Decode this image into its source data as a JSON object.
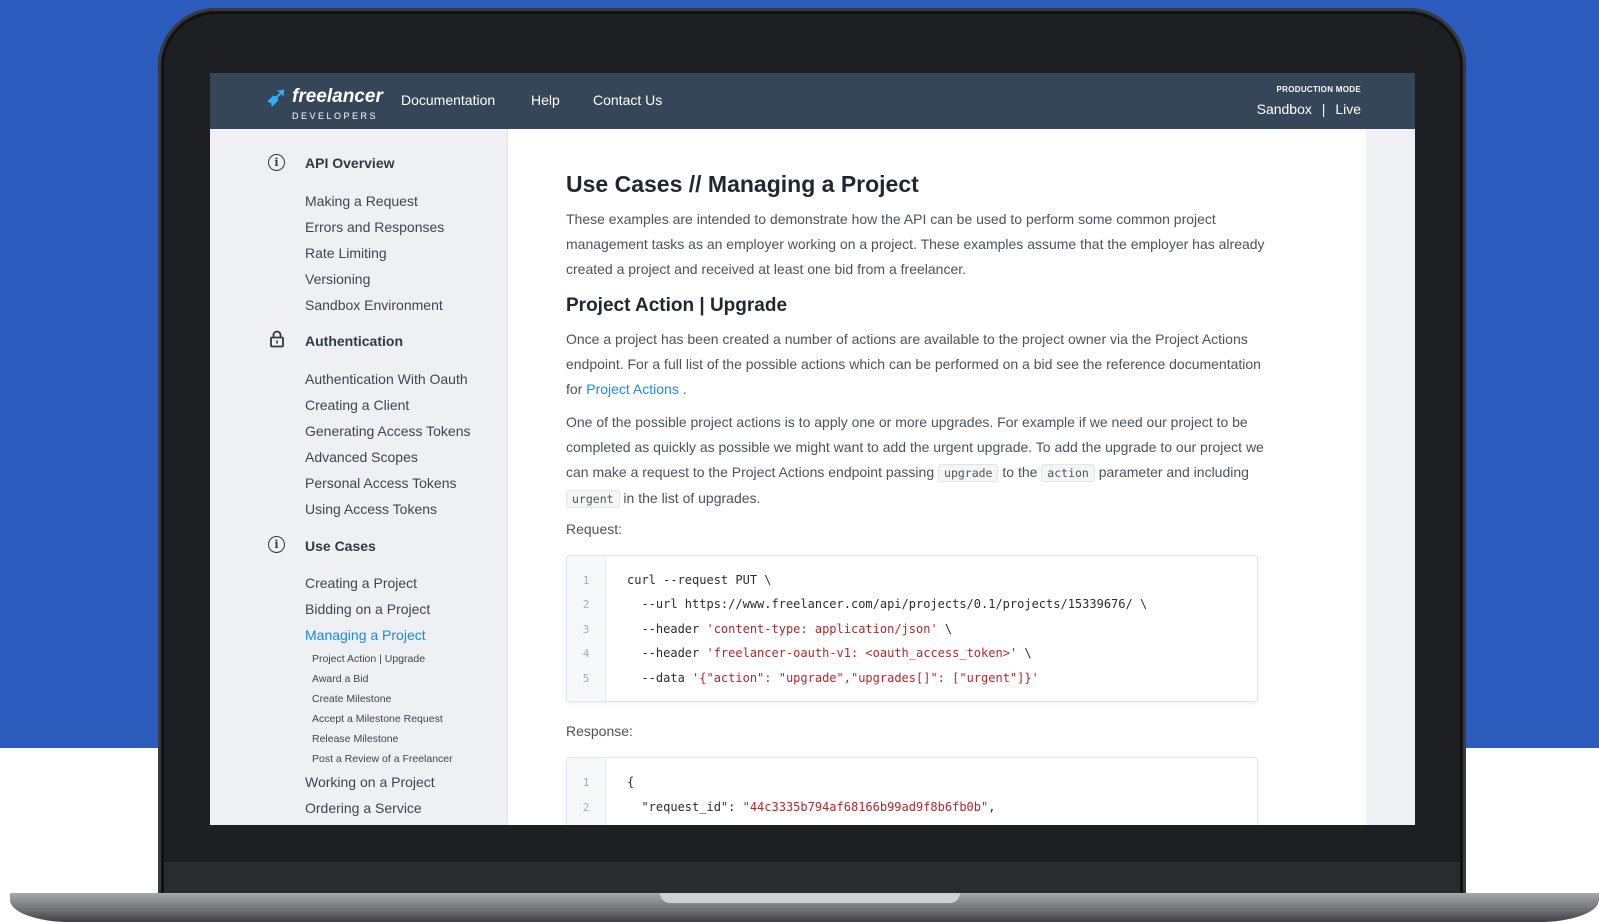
{
  "nav": {
    "logo_word": "freelancer",
    "logo_sub": "DEVELOPERS",
    "links": [
      "Documentation",
      "Help",
      "Contact Us"
    ],
    "mode_label": "PRODUCTION MODE",
    "mode_sandbox": "Sandbox",
    "mode_sep": "|",
    "mode_live": "Live"
  },
  "sidebar": {
    "sections": [
      {
        "title": "API Overview",
        "icon": "info-icon",
        "items": [
          "Making a Request",
          "Errors and Responses",
          "Rate Limiting",
          "Versioning",
          "Sandbox Environment"
        ]
      },
      {
        "title": "Authentication",
        "icon": "lock-icon",
        "items": [
          "Authentication With Oauth",
          "Creating a Client",
          "Generating Access Tokens",
          "Advanced Scopes",
          "Personal Access Tokens",
          "Using Access Tokens"
        ]
      },
      {
        "title": "Use Cases",
        "icon": "info-icon",
        "items": [
          "Creating a Project",
          "Bidding on a Project",
          "Managing a Project"
        ],
        "active_item": "Managing a Project",
        "subitems": [
          "Project Action | Upgrade",
          "Award a Bid",
          "Create Milestone",
          "Accept a Milestone Request",
          "Release Milestone",
          "Post a Review of a Freelancer"
        ],
        "after_items": [
          "Working on a Project",
          "Ordering a Service"
        ]
      }
    ]
  },
  "content": {
    "title": "Use Cases // Managing a Project",
    "intro": "These examples are intended to demonstrate how the API can be used to perform some common project management tasks as an employer working on a project. These examples assume that the employer has already created a project and received at least one bid from a freelancer.",
    "h2": "Project Action | Upgrade",
    "p1_before": "Once a project has been created a number of actions are available to the project owner via the Project Actions endpoint. For a full list of the possible actions which can be performed on a bid see the reference documentation for ",
    "p1_link": "Project Actions",
    "p1_after": " .",
    "p2_a": "One of the possible project actions is to apply one or more upgrades. For example if we need our project to be completed as quickly as possible we might want to add the urgent upgrade. To add the upgrade to our project we can make a request to the Project Actions endpoint passing ",
    "p2_code1": "upgrade",
    "p2_b": " to the ",
    "p2_code2": "action",
    "p2_c": " parameter and including ",
    "p2_code3": "urgent",
    "p2_d": " in the list of upgrades.",
    "request_label": "Request:",
    "response_label": "Response:",
    "request_lines": [
      {
        "n": "1",
        "plain": "curl --request PUT \\",
        "str": "",
        "tail": ""
      },
      {
        "n": "2",
        "plain": "  --url https://www.freelancer.com/api/projects/0.1/projects/15339676/ \\",
        "str": "",
        "tail": ""
      },
      {
        "n": "3",
        "plain": "  --header ",
        "str": "'content-type: application/json'",
        "tail": " \\"
      },
      {
        "n": "4",
        "plain": "  --header ",
        "str": "'freelancer-oauth-v1: <oauth_access_token>'",
        "tail": " \\"
      },
      {
        "n": "5",
        "plain": "  --data ",
        "str": "'{\"action\": \"upgrade\",\"upgrades[]\": [\"urgent\"]}'",
        "tail": ""
      }
    ],
    "response_lines": [
      {
        "n": "1",
        "plain": "{",
        "str": "",
        "tail": ""
      },
      {
        "n": "2",
        "plain": "  \"request_id\": ",
        "str": "\"44c3335b794af68166b99ad9f8b6fb0b\"",
        "tail": ","
      }
    ]
  },
  "colors": {
    "background": "#2b5cbd",
    "nav": "#364659",
    "accent": "#1e88e5",
    "string": "#b5262b"
  }
}
